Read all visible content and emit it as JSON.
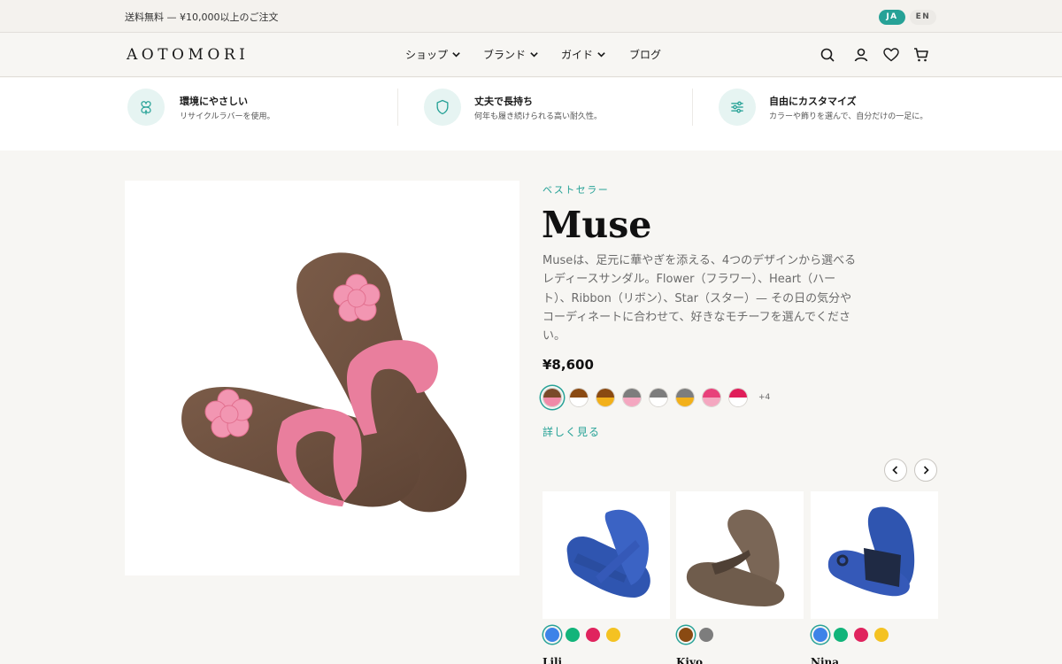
{
  "announcement": "送料無料 — ¥10,000以上のご注文",
  "languages": [
    {
      "label": "JA",
      "active": true
    },
    {
      "label": "EN",
      "active": false
    }
  ],
  "header": {
    "logo": "AOTOMORI",
    "nav": [
      "ショップ",
      "ブランド",
      "ガイド",
      "ブログ"
    ],
    "icons": [
      "search-icon",
      "account-icon",
      "wishlist-heart-icon",
      "cart-icon"
    ]
  },
  "features": [
    {
      "title": "環境にやさしい",
      "subtitle": "リサイクルラバーを使用。",
      "icon": "clover-icon"
    },
    {
      "title": "丈夫で長持ち",
      "subtitle": "何年も履き続けられる高い耐久性。",
      "icon": "shield-icon"
    },
    {
      "title": "自由にカスタマイズ",
      "subtitle": "カラーや飾りを選んで、自分だけの一足に。",
      "icon": "sliders-icon"
    }
  ],
  "product": {
    "badge": "ベストセラー",
    "name": "Muse",
    "description": "Museは、足元に華やぎを添える、4つのデザインから選べるレディースサンダル。Flower（フラワー）、Heart（ハート）、Ribbon（リボン）、Star（スター）— その日の気分やコーディネートに合わせて、好きなモチーフを選んでください。",
    "price": "¥8,600",
    "swatches": [
      {
        "top": "#7a4a2a",
        "bottom": "#f08aa8",
        "selected": true
      },
      {
        "top": "#8a4a12",
        "bottom": "#ffffff",
        "selected": false
      },
      {
        "top": "#8a4a12",
        "bottom": "#f2b01a",
        "selected": false
      },
      {
        "top": "#7d7d7d",
        "bottom": "#f4a7c0",
        "selected": false
      },
      {
        "top": "#7d7d7d",
        "bottom": "#ffffff",
        "selected": false
      },
      {
        "top": "#7d7d7d",
        "bottom": "#f2b01a",
        "selected": false
      },
      {
        "top": "#e8407a",
        "bottom": "#f4a7c0",
        "selected": false
      },
      {
        "top": "#e01e5a",
        "bottom": "#ffffff",
        "selected": false
      }
    ],
    "more_colors": "+4",
    "details_link": "詳しく見る"
  },
  "related": [
    {
      "name": "Lili",
      "colors": [
        "#3d83e8",
        "#12b47a",
        "#e0245e",
        "#f4c222"
      ],
      "selected_index": 0
    },
    {
      "name": "Kiyo",
      "colors": [
        "#8a4a12",
        "#7d7d7d"
      ],
      "selected_index": 0
    },
    {
      "name": "Nina",
      "colors": [
        "#3d83e8",
        "#12b47a",
        "#e0245e",
        "#f4c222"
      ],
      "selected_index": 0
    }
  ],
  "colors": {
    "accent": "#27a297",
    "background": "#f7f6f3"
  }
}
